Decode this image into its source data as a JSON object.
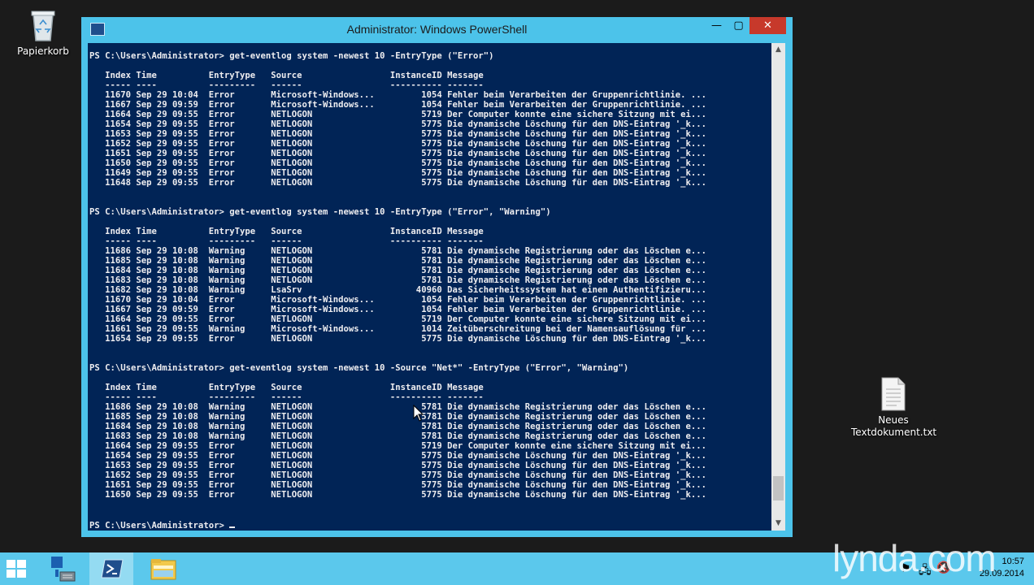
{
  "desktop": {
    "icons": [
      {
        "label": "Papierkorb"
      },
      {
        "label_line1": "Neues",
        "label_line2": "Textdokument.txt"
      }
    ]
  },
  "window": {
    "title": "Administrator: Windows PowerShell",
    "buttons": {
      "minimize": "—",
      "maximize": "▢",
      "close": "✕"
    }
  },
  "console": {
    "lines": [
      "PS C:\\Users\\Administrator> get-eventlog system -newest 10 -EntryType (\"Error\")",
      "",
      "   Index Time          EntryType   Source                 InstanceID Message",
      "   ----- ----          ---------   ------                 ---------- -------",
      "   11670 Sep 29 10:04  Error       Microsoft-Windows...         1054 Fehler beim Verarbeiten der Gruppenrichtlinie. ...",
      "   11667 Sep 29 09:59  Error       Microsoft-Windows...         1054 Fehler beim Verarbeiten der Gruppenrichtlinie. ...",
      "   11664 Sep 29 09:55  Error       NETLOGON                     5719 Der Computer konnte eine sichere Sitzung mit ei...",
      "   11654 Sep 29 09:55  Error       NETLOGON                     5775 Die dynamische Löschung für den DNS-Eintrag '_k...",
      "   11653 Sep 29 09:55  Error       NETLOGON                     5775 Die dynamische Löschung für den DNS-Eintrag '_k...",
      "   11652 Sep 29 09:55  Error       NETLOGON                     5775 Die dynamische Löschung für den DNS-Eintrag '_k...",
      "   11651 Sep 29 09:55  Error       NETLOGON                     5775 Die dynamische Löschung für den DNS-Eintrag '_k...",
      "   11650 Sep 29 09:55  Error       NETLOGON                     5775 Die dynamische Löschung für den DNS-Eintrag '_k...",
      "   11649 Sep 29 09:55  Error       NETLOGON                     5775 Die dynamische Löschung für den DNS-Eintrag '_k...",
      "   11648 Sep 29 09:55  Error       NETLOGON                     5775 Die dynamische Löschung für den DNS-Eintrag '_k...",
      "",
      "",
      "PS C:\\Users\\Administrator> get-eventlog system -newest 10 -EntryType (\"Error\", \"Warning\")",
      "",
      "   Index Time          EntryType   Source                 InstanceID Message",
      "   ----- ----          ---------   ------                 ---------- -------",
      "   11686 Sep 29 10:08  Warning     NETLOGON                     5781 Die dynamische Registrierung oder das Löschen e...",
      "   11685 Sep 29 10:08  Warning     NETLOGON                     5781 Die dynamische Registrierung oder das Löschen e...",
      "   11684 Sep 29 10:08  Warning     NETLOGON                     5781 Die dynamische Registrierung oder das Löschen e...",
      "   11683 Sep 29 10:08  Warning     NETLOGON                     5781 Die dynamische Registrierung oder das Löschen e...",
      "   11682 Sep 29 10:08  Warning     LsaSrv                      40960 Das Sicherheitssystem hat einen Authentifizieru...",
      "   11670 Sep 29 10:04  Error       Microsoft-Windows...         1054 Fehler beim Verarbeiten der Gruppenrichtlinie. ...",
      "   11667 Sep 29 09:59  Error       Microsoft-Windows...         1054 Fehler beim Verarbeiten der Gruppenrichtlinie. ...",
      "   11664 Sep 29 09:55  Error       NETLOGON                     5719 Der Computer konnte eine sichere Sitzung mit ei...",
      "   11661 Sep 29 09:55  Warning     Microsoft-Windows...         1014 Zeitüberschreitung bei der Namensauflösung für ...",
      "   11654 Sep 29 09:55  Error       NETLOGON                     5775 Die dynamische Löschung für den DNS-Eintrag '_k...",
      "",
      "",
      "PS C:\\Users\\Administrator> get-eventlog system -newest 10 -Source \"Net*\" -EntryType (\"Error\", \"Warning\")",
      "",
      "   Index Time          EntryType   Source                 InstanceID Message",
      "   ----- ----          ---------   ------                 ---------- -------",
      "   11686 Sep 29 10:08  Warning     NETLOGON                     5781 Die dynamische Registrierung oder das Löschen e...",
      "   11685 Sep 29 10:08  Warning     NETLOGON                     5781 Die dynamische Registrierung oder das Löschen e...",
      "   11684 Sep 29 10:08  Warning     NETLOGON                     5781 Die dynamische Registrierung oder das Löschen e...",
      "   11683 Sep 29 10:08  Warning     NETLOGON                     5781 Die dynamische Registrierung oder das Löschen e...",
      "   11664 Sep 29 09:55  Error       NETLOGON                     5719 Der Computer konnte eine sichere Sitzung mit ei...",
      "   11654 Sep 29 09:55  Error       NETLOGON                     5775 Die dynamische Löschung für den DNS-Eintrag '_k...",
      "   11653 Sep 29 09:55  Error       NETLOGON                     5775 Die dynamische Löschung für den DNS-Eintrag '_k...",
      "   11652 Sep 29 09:55  Error       NETLOGON                     5775 Die dynamische Löschung für den DNS-Eintrag '_k...",
      "   11651 Sep 29 09:55  Error       NETLOGON                     5775 Die dynamische Löschung für den DNS-Eintrag '_k...",
      "   11650 Sep 29 09:55  Error       NETLOGON                     5775 Die dynamische Löschung für den DNS-Eintrag '_k...",
      "",
      "",
      "PS C:\\Users\\Administrator> "
    ]
  },
  "taskbar": {
    "items": [
      "start-icon",
      "server-manager-icon",
      "powershell-icon",
      "file-explorer-icon"
    ],
    "tray": {
      "time": "10:57",
      "date": "29.09.2014"
    }
  },
  "watermark": "lynda.com",
  "colors": {
    "console_bg": "#012456",
    "window_frame": "#4cc3ea",
    "taskbar": "#5bc8ec",
    "close_button": "#c7392b"
  }
}
